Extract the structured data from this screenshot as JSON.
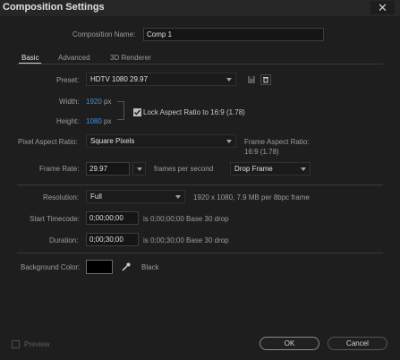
{
  "window": {
    "title": "Composition Settings",
    "close_glyph": "✕"
  },
  "comp_name": {
    "label": "Composition Name:",
    "value": "Comp 1"
  },
  "tabs": [
    {
      "label": "Basic"
    },
    {
      "label": "Advanced"
    },
    {
      "label": "3D Renderer"
    }
  ],
  "preset": {
    "label": "Preset:",
    "value": "HDTV 1080 29.97"
  },
  "width": {
    "label": "Width:",
    "value": "1920",
    "unit": "px"
  },
  "height": {
    "label": "Height:",
    "value": "1080",
    "unit": "px"
  },
  "lock_aspect": {
    "label": "Lock Aspect Ratio to 16:9 (1.78)",
    "checked": true
  },
  "pixel_aspect": {
    "label": "Pixel Aspect Ratio:",
    "value": "Square Pixels"
  },
  "frame_aspect": {
    "label": "Frame Aspect Ratio:",
    "value": "16:9 (1.78)"
  },
  "frame_rate": {
    "label": "Frame Rate:",
    "value": "29.97",
    "unit": "frames per second",
    "mode": "Drop Frame"
  },
  "resolution": {
    "label": "Resolution:",
    "value": "Full",
    "info": "1920 x 1080, 7.9 MB per 8bpc frame"
  },
  "start_timecode": {
    "label": "Start Timecode:",
    "value": "0;00;00;00",
    "info": "is 0;00;00;00  Base 30  drop"
  },
  "duration": {
    "label": "Duration:",
    "value": "0;00;30;00",
    "info": "is 0;00;30;00  Base 30  drop"
  },
  "background": {
    "label": "Background Color:",
    "color_name": "Black",
    "swatch_color": "#000000"
  },
  "footer": {
    "preview_label": "Preview",
    "ok_label": "OK",
    "cancel_label": "Cancel"
  },
  "colors": {
    "accent_blue": "#3d93e0",
    "background": "#1e1e1e"
  }
}
